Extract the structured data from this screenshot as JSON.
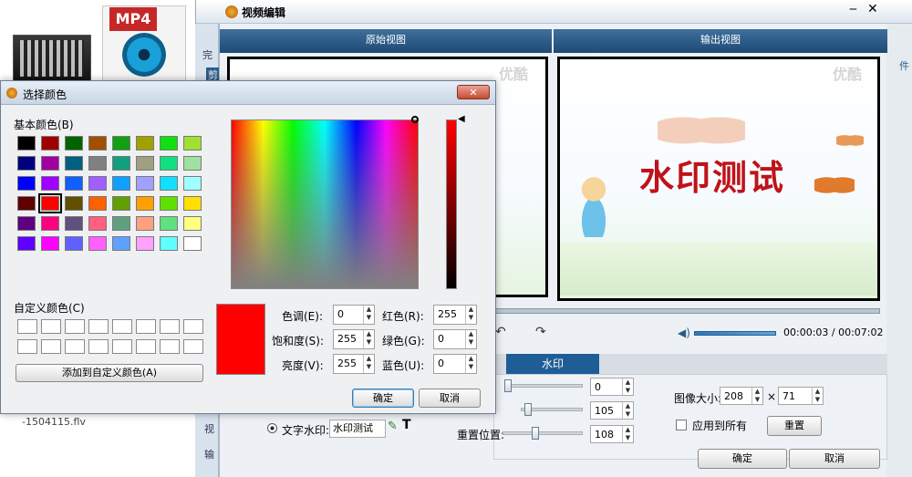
{
  "desktop": {
    "mp4_badge": "MP4",
    "file_caption": "-1504115.flv"
  },
  "editor": {
    "title": "视频编辑",
    "original_view": "原始视图",
    "output_view": "输出视图",
    "watermark_text": "水印测试",
    "logo": "优酷",
    "time_display": "00:00:03 / 00:07:02",
    "tab_watermark": "水印",
    "slider_values": [
      "0",
      "105",
      "108"
    ],
    "reset_position_label": "重置位置:",
    "text_watermark_label": "文字水印:",
    "text_watermark_value": "水印测试",
    "image_size_label": "图像大小:",
    "image_width": "208",
    "size_sep": "×",
    "image_height": "71",
    "apply_all_label": "应用到所有",
    "reset_button": "重置",
    "ok_button": "确定",
    "cancel_button": "取消",
    "side_fragments": [
      "完",
      "剪",
      "视",
      "输"
    ],
    "right_fragment": "件"
  },
  "dialog": {
    "title": "选择颜色",
    "basic_colors_label": "基本颜色(B)",
    "custom_colors_label": "自定义颜色(C)",
    "add_custom_button": "添加到自定义颜色(A)",
    "hue_label": "色调(E):",
    "hue_value": "0",
    "saturation_label": "饱和度(S):",
    "saturation_value": "255",
    "luminance_label": "亮度(V):",
    "luminance_value": "255",
    "red_label": "红色(R):",
    "red_value": "255",
    "green_label": "绿色(G):",
    "green_value": "0",
    "blue_label": "蓝色(U):",
    "blue_value": "0",
    "ok_button": "确定",
    "cancel_button": "取消",
    "selected_color": "#ff0000",
    "basic_colors": [
      [
        "#000000",
        "#a00000",
        "#006400",
        "#a05000",
        "#10a010",
        "#a0a000",
        "#10e010",
        "#a0e030"
      ],
      [
        "#000080",
        "#a000a0",
        "#006080",
        "#808080",
        "#10a080",
        "#a0a080",
        "#10e080",
        "#a0e0a0"
      ],
      [
        "#0000ff",
        "#a000ff",
        "#1060ff",
        "#a060ff",
        "#10a0ff",
        "#a0a0ff",
        "#10e0ff",
        "#a0ffff"
      ],
      [
        "#600000",
        "#ff0000",
        "#605000",
        "#ff6000",
        "#60a000",
        "#ffa000",
        "#60e000",
        "#ffe000"
      ],
      [
        "#600080",
        "#ff0080",
        "#605080",
        "#ff6080",
        "#60a080",
        "#ffa080",
        "#60e080",
        "#ffff80"
      ],
      [
        "#6000ff",
        "#ff00ff",
        "#6060ff",
        "#ff60ff",
        "#60a0ff",
        "#ffa0ff",
        "#60ffff",
        "#ffffff"
      ]
    ],
    "selected_index": [
      3,
      1
    ]
  }
}
